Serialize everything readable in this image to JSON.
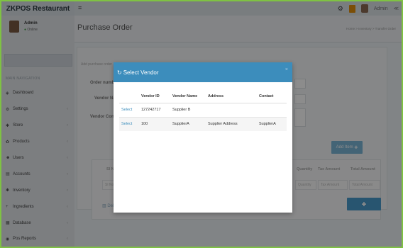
{
  "app": {
    "brand": "ZKPOS Restaurant"
  },
  "topbar": {
    "user_label": "Admin",
    "icons": [
      "gear-icon",
      "bell-icon",
      "avatar",
      "share-icon"
    ]
  },
  "sidebar": {
    "user_name": "Admin",
    "user_status": "Online",
    "nav_header": "MAIN NAVIGATION",
    "items": [
      {
        "label": "Dashboard",
        "icon": "dashboard-icon"
      },
      {
        "label": "Settings",
        "icon": "gear-icon"
      },
      {
        "label": "Store",
        "icon": "store-icon"
      },
      {
        "label": "Products",
        "icon": "products-icon"
      },
      {
        "label": "Users",
        "icon": "users-icon"
      },
      {
        "label": "Accounts",
        "icon": "accounts-icon"
      },
      {
        "label": "Inventory",
        "icon": "inventory-icon"
      },
      {
        "label": "Ingredients",
        "icon": "plus-icon"
      },
      {
        "label": "Database",
        "icon": "database-icon"
      },
      {
        "label": "Pos Reports",
        "icon": "reports-icon"
      }
    ]
  },
  "page": {
    "title": "Purchase Order",
    "breadcrumb": "Home > Inventory > Transfer Order",
    "subtitle": "Add purchase order",
    "labels": {
      "order_number": "Order numbe",
      "vendor_name": "Vendor Nar",
      "vendor_contact": "Vendor Conta",
      "add_item": "Add Item",
      "delete": "Delete"
    },
    "table_headers": [
      "Sl No.",
      "Quantity",
      "Tax Amount",
      "Total Amount"
    ],
    "table_placeholders": [
      "Sl No",
      "Quantity",
      "Tax Amount",
      "Total Amount"
    ]
  },
  "modal": {
    "title": "Select Vendor",
    "columns": [
      "",
      "Vendor ID",
      "Vendor Name",
      "Address",
      "Contact"
    ],
    "rows": [
      {
        "action": "Select",
        "vendor_id": "127242717",
        "vendor_name": "Supplier B",
        "address": "",
        "contact": ""
      },
      {
        "action": "Select",
        "vendor_id": "100",
        "vendor_name": "SupplierA",
        "address": "Supplier Address",
        "contact": "SupplierA"
      }
    ]
  },
  "colors": {
    "accent": "#3c8dbc",
    "frame": "#7fc243",
    "online": "#3c9a3c"
  }
}
